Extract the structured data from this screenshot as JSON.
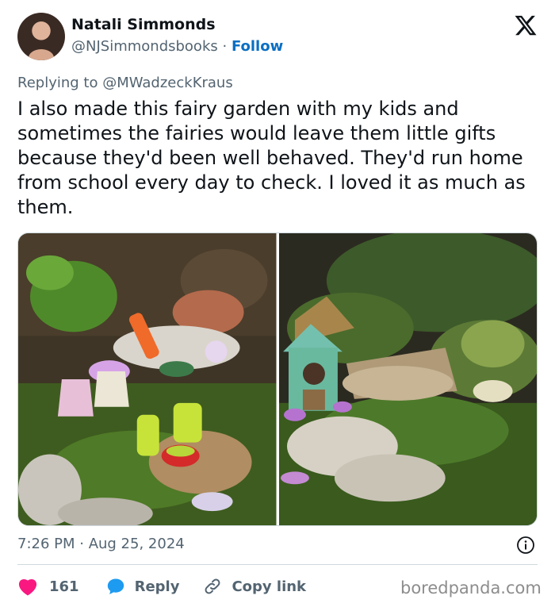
{
  "author": {
    "name": "Natali Simmonds",
    "handle": "@NJSimmondsbooks",
    "separator": "·",
    "follow_label": "Follow"
  },
  "reply_to": {
    "prefix": "Replying to",
    "mention": "@MWadzeckKraus"
  },
  "tweet": {
    "text": "I also made this fairy garden with my kids and sometimes the fairies would leave them little gifts because they'd been well behaved. They'd run home from school every day to check. I loved it as much as them.",
    "timestamp": "7:26 PM · Aug 25, 2024"
  },
  "actions": {
    "like_count": "161",
    "reply_label": "Reply",
    "copy_link_label": "Copy link"
  },
  "watermark": "boredpanda.com",
  "colors": {
    "like_red": "#f91880",
    "reply_blue": "#1d9bf0",
    "follow_blue": "#0a6fc2",
    "muted_text": "#536471"
  },
  "icons": {
    "x_logo": "x-logo-icon",
    "info": "info-icon",
    "like": "heart-icon",
    "reply": "reply-bubble-icon",
    "copy": "link-icon"
  }
}
